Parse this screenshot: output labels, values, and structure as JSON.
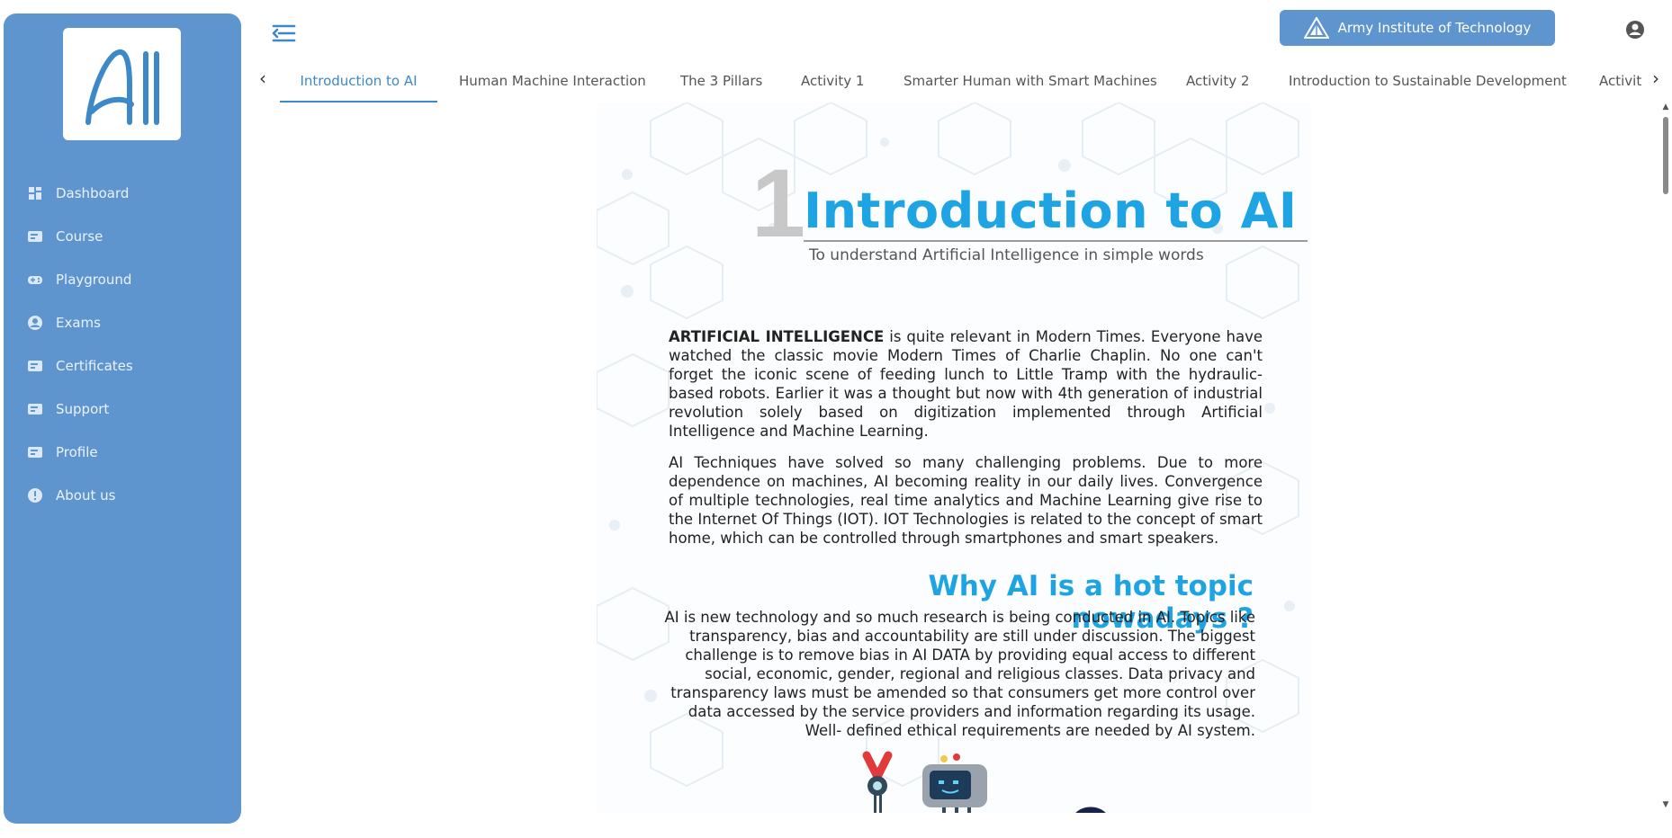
{
  "sidebar": {
    "logo_text": "AI",
    "items": [
      {
        "label": "Dashboard",
        "icon": "dashboard-icon"
      },
      {
        "label": "Course",
        "icon": "course-icon"
      },
      {
        "label": "Playground",
        "icon": "gamepad-icon"
      },
      {
        "label": "Exams",
        "icon": "exam-icon"
      },
      {
        "label": "Certificates",
        "icon": "certificate-icon"
      },
      {
        "label": "Support",
        "icon": "support-icon"
      },
      {
        "label": "Profile",
        "icon": "profile-icon"
      },
      {
        "label": "About us",
        "icon": "info-icon"
      }
    ]
  },
  "header": {
    "org_name": "Army Institute of Technology",
    "hamburger_icon": "menu-collapse-icon",
    "user_icon": "account-circle-icon"
  },
  "tabs": {
    "items": [
      {
        "label": "Introduction to AI",
        "active": true
      },
      {
        "label": "Human Machine Interaction",
        "active": false
      },
      {
        "label": "The 3 Pillars",
        "active": false
      },
      {
        "label": "Activity 1",
        "active": false
      },
      {
        "label": "Smarter Human with Smart Machines",
        "active": false
      },
      {
        "label": "Activity 2",
        "active": false
      },
      {
        "label": "Introduction to Sustainable Development",
        "active": false
      },
      {
        "label": "Activit",
        "active": false
      }
    ]
  },
  "content": {
    "chapter_number": "1",
    "chapter_title": "Introduction to AI",
    "chapter_subtitle": "To understand Artificial Intelligence in simple words",
    "para1_bold": "ARTIFICIAL INTELLIGENCE",
    "para1_rest": " is quite relevant in Modern Times. Everyone have watched the classic movie Modern Times of Charlie Chaplin. No one can't forget the iconic scene of feeding lunch to Little Tramp with the hydraulic-based robots. Earlier it was a thought but now with 4th generation of industrial revolution solely based on digitization implemented through Artificial Intelligence and Machine Learning.",
    "para2": "AI Techniques have solved so many challenging problems. Due to more dependence on machines, AI becoming reality in our daily lives. Convergence of multiple technologies, real time analytics and Machine Learning give rise to the Internet Of Things (IOT). IOT Technologies is related to the concept of smart home, which can be controlled through smartphones and smart speakers.",
    "subheading": "Why AI is a hot topic nowadays ?",
    "para3": "AI is new technology and so much research is being conducted in AI. Topics like transparency, bias and accountability are still under discussion. The biggest challenge is to remove bias in AI DATA by providing equal access to different social, economic, gender, regional and religious classes. Data privacy and transparency laws must be amended so that consumers get more control over data accessed by the service providers and information regarding its usage. Well- defined ethical requirements are needed by AI system."
  },
  "colors": {
    "sidebar_bg": "#5f95cf",
    "accent": "#3d88c8",
    "title_blue": "#1ea4e3"
  }
}
